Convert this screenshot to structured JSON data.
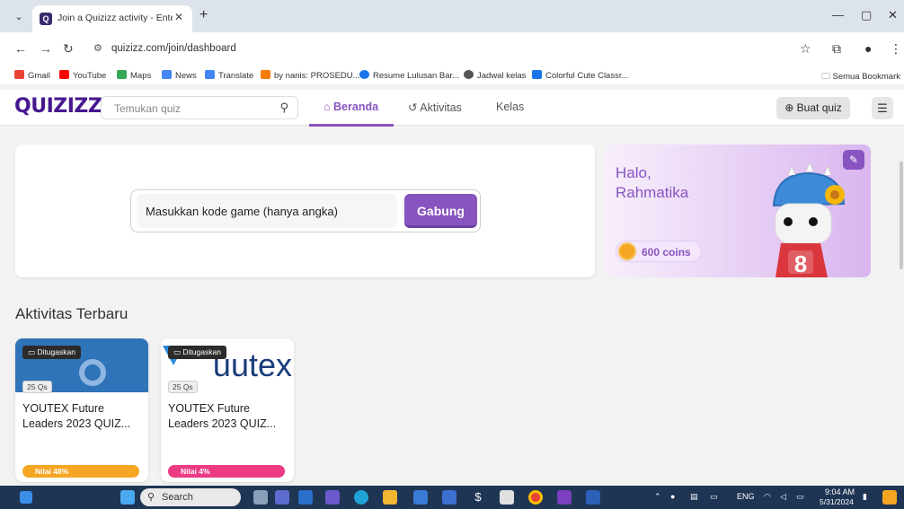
{
  "browser": {
    "tab_title": "Join a Quizizz activity - Enter co",
    "tab_favicon": "Q",
    "url": "quizizz.com/join/dashboard",
    "bookmarks": [
      {
        "label": "Gmail",
        "color": "#ea4335"
      },
      {
        "label": "YouTube",
        "color": "#ff0000"
      },
      {
        "label": "Maps",
        "color": "#34a853"
      },
      {
        "label": "News",
        "color": "#4285f4"
      },
      {
        "label": "Translate",
        "color": "#4285f4"
      },
      {
        "label": "by nanis: PROSEDU...",
        "color": "#f57c00"
      },
      {
        "label": "Resume Lulusan Bar...",
        "color": "#1a73e8"
      },
      {
        "label": "Jadwal kelas",
        "color": "#555555"
      },
      {
        "label": "Colorful Cute Classr...",
        "color": "#1a73e8"
      }
    ],
    "bookmarks_folder": "Semua Bookmark"
  },
  "header": {
    "logo": "QUIZIZZ",
    "search_placeholder": "Temukan quiz",
    "nav": [
      {
        "label": "Beranda",
        "icon": "home-icon",
        "active": true
      },
      {
        "label": "Aktivitas",
        "icon": "history-icon",
        "active": false
      },
      {
        "label": "Kelas",
        "icon": "",
        "active": false
      }
    ],
    "create_label": "Buat quiz"
  },
  "join": {
    "placeholder": "Masukkan kode game (hanya angka)",
    "button": "Gabung"
  },
  "profile": {
    "greeting": "Halo,",
    "name": "Rahmatika",
    "coins": "600 coins",
    "jersey_number": "8"
  },
  "activities": {
    "title": "Aktivitas Terbaru",
    "items": [
      {
        "badge": "Ditugaskan",
        "questions": "25 Qs",
        "name": "YOUTEX Future Leaders 2023 QUIZ...",
        "score": "Nilai 48%",
        "score_color": "#f5a623",
        "thumb": "blue"
      },
      {
        "badge": "Ditugaskan",
        "questions": "25 Qs",
        "name": "YOUTEX Future Leaders 2023 QUIZ...",
        "score": "Nilai 4%",
        "score_color": "#ec3b83",
        "thumb": "youtex",
        "thumb_text": "uutex"
      }
    ]
  },
  "taskbar": {
    "search": "Search",
    "lang": "ENG",
    "time": "9:04 AM",
    "date": "5/31/2024"
  },
  "colors": {
    "brand": "#46178f",
    "accent": "#8854c0"
  }
}
